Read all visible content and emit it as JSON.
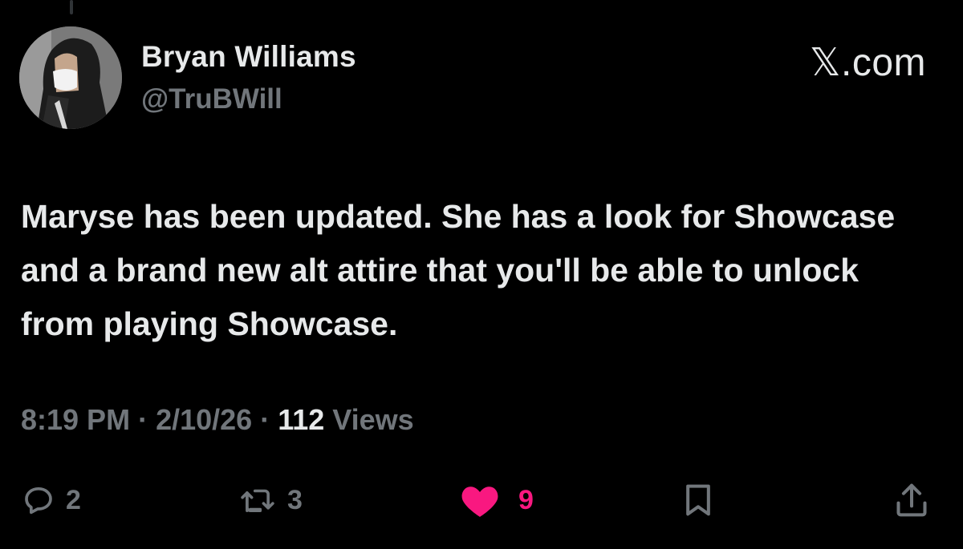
{
  "author": {
    "display_name": "Bryan Williams",
    "handle": "@TruBWill"
  },
  "brand": "𝕏.com",
  "tweet": {
    "text": "Maryse has been updated. She has a look for Showcase and a brand new alt attire that you'll be able to unlock from playing Showcase."
  },
  "meta": {
    "time": "8:19 PM",
    "separator": " · ",
    "date": "2/10/26",
    "views_count": "112",
    "views_label": "Views"
  },
  "actions": {
    "replies": {
      "icon": "reply-icon",
      "count": "2"
    },
    "reposts": {
      "icon": "repost-icon",
      "count": "3"
    },
    "likes": {
      "icon": "heart-icon",
      "count": "9",
      "active": true
    },
    "bookmark": {
      "icon": "bookmark-icon"
    },
    "share": {
      "icon": "share-icon"
    }
  },
  "colors": {
    "background": "#000000",
    "primary_text": "#e7e9ea",
    "secondary_text": "#71767b",
    "like_active": "#f91880"
  }
}
